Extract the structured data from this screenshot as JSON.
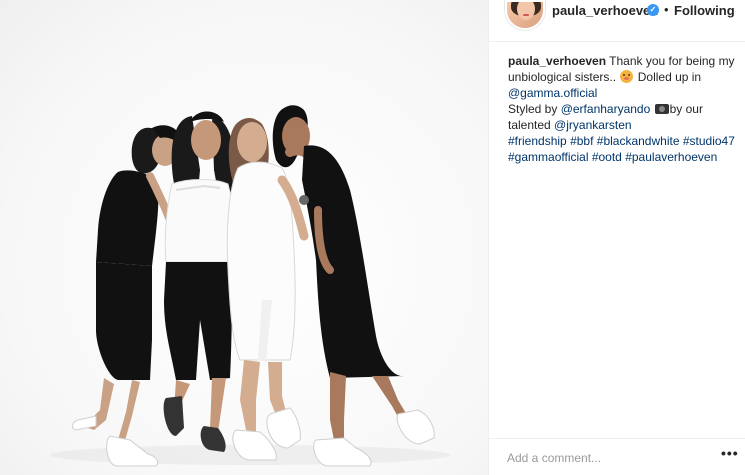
{
  "post": {
    "username": "paula_verhoeven",
    "verified_icon": "verified-badge-icon",
    "separator": "•",
    "follow_status": "Following",
    "caption": {
      "username": "paula_verhoeven",
      "text_1": " Thank you for being my unbiological sisters.. ",
      "emoji_1": "smiling-face-emoji",
      "text_2": " Dolled up in ",
      "mention_1": "@gamma.official",
      "text_3": "Styled by ",
      "mention_2": "@erfanharyando",
      "emoji_2": "camera-emoji",
      "text_4": "by our talented ",
      "mention_3": "@jryankarsten",
      "hashtags": [
        "#friendship",
        "#bbf",
        "#blackandwhite",
        "#studio47",
        "#gammaofficial",
        "#ootd",
        "#paulaverhoeven"
      ]
    },
    "comment_placeholder": "Add a comment...",
    "more_options": "•••"
  },
  "colors": {
    "link": "#003569",
    "text": "#262626",
    "border": "#efefef",
    "verified": "#3897f0"
  }
}
